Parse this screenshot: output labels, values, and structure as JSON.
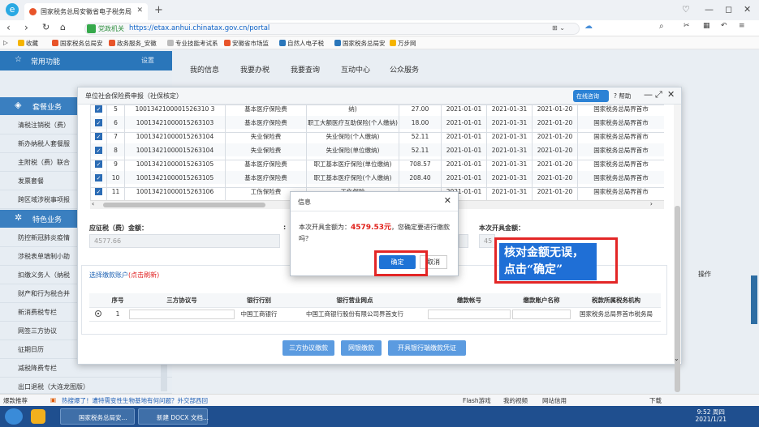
{
  "browser": {
    "tab_title": "国家税务总局安徽省电子税务局",
    "address_site": "党政机关",
    "address_url": "https://etax.anhui.chinatax.gov.cn/portal",
    "bookmarks": [
      "收藏",
      "国家税务总局安",
      "政务服务_安徽",
      "专业技能考试系",
      "安徽省市场监",
      "自然人电子税",
      "国家税务总局安",
      "万步网"
    ]
  },
  "top_nav": [
    "我的信息",
    "我要办税",
    "我要查询",
    "互动中心",
    "公众服务"
  ],
  "sidebar": {
    "header": "常用功能",
    "header_right": "设置",
    "section1": "套餐业务",
    "items1": [
      "清税注销税（费）",
      "新办纳税人套餐服",
      "主附税（费）联合",
      "发票套餐",
      "跨区域涉税事项报"
    ],
    "section2": "特色业务",
    "items2": [
      "防控新冠肺炎疫情",
      "涉税表单填制小助",
      "扣缴义务人（纳税",
      "财产和行为税合并",
      "新消费税专栏",
      "网签三方协议",
      "征期日历",
      "减税降费专栏",
      "出口退税（大连龙图版）"
    ]
  },
  "dialog": {
    "title": "单位社会保险费申报（社保核定）",
    "online_cs": "在线咨询",
    "help": "帮助",
    "rows": [
      {
        "no": "5",
        "id": "1001342100001526310 3",
        "type": "基本医疗保险费",
        "item": "纳)",
        "amt": "27.00",
        "start": "2021-01-01",
        "end": "2021-01-31",
        "due": "2021-01-20",
        "org": "国家税务总局界首市"
      },
      {
        "no": "6",
        "id": "10013421000015263103",
        "type": "基本医疗保险费",
        "item": "职工大额医疗互助保险(个人缴纳)",
        "amt": "18.00",
        "start": "2021-01-01",
        "end": "2021-01-31",
        "due": "2021-01-20",
        "org": "国家税务总局界首市"
      },
      {
        "no": "7",
        "id": "10013421000015263104",
        "type": "失业保险费",
        "item": "失业保险(个人缴纳)",
        "amt": "52.11",
        "start": "2021-01-01",
        "end": "2021-01-31",
        "due": "2021-01-20",
        "org": "国家税务总局界首市"
      },
      {
        "no": "8",
        "id": "10013421000015263104",
        "type": "失业保险费",
        "item": "失业保险(单位缴纳)",
        "amt": "52.11",
        "start": "2021-01-01",
        "end": "2021-01-31",
        "due": "2021-01-20",
        "org": "国家税务总局界首市"
      },
      {
        "no": "9",
        "id": "10013421000015263105",
        "type": "基本医疗保险费",
        "item": "职工基本医疗保险(单位缴纳)",
        "amt": "708.57",
        "start": "2021-01-01",
        "end": "2021-01-31",
        "due": "2021-01-20",
        "org": "国家税务总局界首市"
      },
      {
        "no": "10",
        "id": "10013421000015263105",
        "type": "基本医疗保险费",
        "item": "职工基本医疗保险(个人缴纳)",
        "amt": "208.40",
        "start": "2021-01-01",
        "end": "2021-01-31",
        "due": "2021-01-20",
        "org": "国家税务总局界首市"
      },
      {
        "no": "11",
        "id": "10013421000015263106",
        "type": "工伤保险费",
        "item": "工伤保险",
        "amt": "",
        "start": "2021-01-01",
        "end": "2021-01-31",
        "due": "2021-01-20",
        "org": "国家税务总局界首市"
      }
    ],
    "due_label": "应征税（费）金额：",
    "due_value": "4577.66",
    "current_label": "本次开具金额：",
    "current_value": "45",
    "pay_title": "选择缴款账户",
    "pay_refresh": "(点击刷新)",
    "pay_headers": [
      "序号",
      "三方协议号",
      "银行行别",
      "银行营业网点",
      "缴款帐号",
      "缴款账户名称",
      "税款所属税务机构"
    ],
    "pay_row": {
      "no": "1",
      "bank": "中国工商银行",
      "branch": "中国工商银行股份有限公司界首支行",
      "org": "国家税务总局界首市税务局"
    },
    "buttons": [
      "三方协议缴款",
      "网银缴款",
      "开具银行端缴款凭证"
    ],
    "right_col_label": "操作"
  },
  "message": {
    "title": "信息",
    "text_pre": "本次开具金额为：",
    "amount": "4579.53元",
    "text_post": "，您确定要进行缴款吗？",
    "ok": "确定",
    "cancel": "取消"
  },
  "annotation": {
    "line1": "核对金额无误，",
    "line2": "点击“确定”"
  },
  "statusbar": {
    "left": "爆款推荐",
    "news": "热搜爆了！遭特需变性生物基地有何问题？外交部西回",
    "right": [
      "Flash游戏",
      "我的视频",
      "网站信用",
      "下载"
    ]
  },
  "taskbar": {
    "task1": "国家税务总局安...",
    "task2": "新建 DOCX 文档...",
    "time": "9:52 周四",
    "date": "2021/1/21"
  }
}
